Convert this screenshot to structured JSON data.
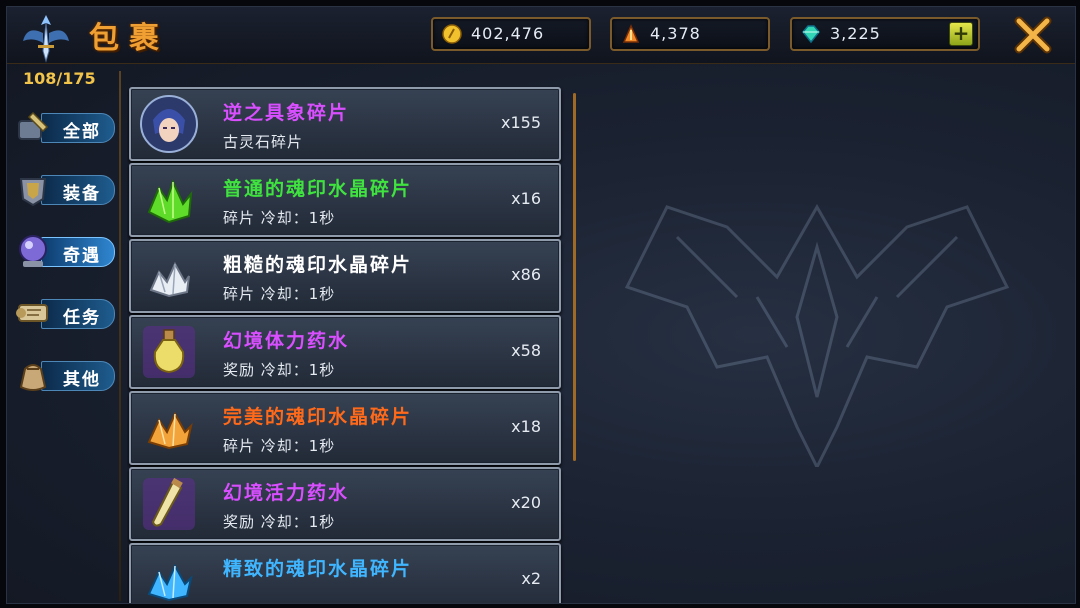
{
  "header": {
    "title": "包裹"
  },
  "resources": [
    {
      "icon": "gold-coin-icon",
      "value": "402,476"
    },
    {
      "icon": "energy-crystal-icon",
      "value": "4,378"
    },
    {
      "icon": "diamond-icon",
      "value": "3,225",
      "plus": "+"
    }
  ],
  "inventory": {
    "count": "108/175"
  },
  "categories": [
    {
      "label": "全部",
      "icon": "all-items-icon"
    },
    {
      "label": "装备",
      "icon": "equipment-icon"
    },
    {
      "label": "奇遇",
      "icon": "adventure-icon"
    },
    {
      "label": "任务",
      "icon": "quest-scroll-icon"
    },
    {
      "label": "其他",
      "icon": "misc-bag-icon"
    }
  ],
  "items": [
    {
      "name": "逆之具象碎片",
      "sub": "古灵石碎片",
      "qty": "x155",
      "color": "#d94fff",
      "icon": "character-portrait-icon"
    },
    {
      "name": "普通的魂印水晶碎片",
      "sub": "碎片 冷却：1秒",
      "qty": "x16",
      "color": "#3fe23f",
      "icon": "green-crystal-icon"
    },
    {
      "name": "粗糙的魂印水晶碎片",
      "sub": "碎片 冷却：1秒",
      "qty": "x86",
      "color": "#ffffff",
      "icon": "white-crystal-icon"
    },
    {
      "name": "幻境体力药水",
      "sub": "奖励 冷却：1秒",
      "qty": "x58",
      "color": "#d94fff",
      "icon": "stamina-potion-icon"
    },
    {
      "name": "完美的魂印水晶碎片",
      "sub": "碎片 冷却：1秒",
      "qty": "x18",
      "color": "#ff6a1a",
      "icon": "orange-crystal-icon"
    },
    {
      "name": "幻境活力药水",
      "sub": "奖励 冷却：1秒",
      "qty": "x20",
      "color": "#d94fff",
      "icon": "vitality-potion-icon"
    },
    {
      "name": "精致的魂印水晶碎片",
      "sub": "",
      "qty": "x2",
      "color": "#3fb6ff",
      "icon": "blue-crystal-icon"
    }
  ]
}
